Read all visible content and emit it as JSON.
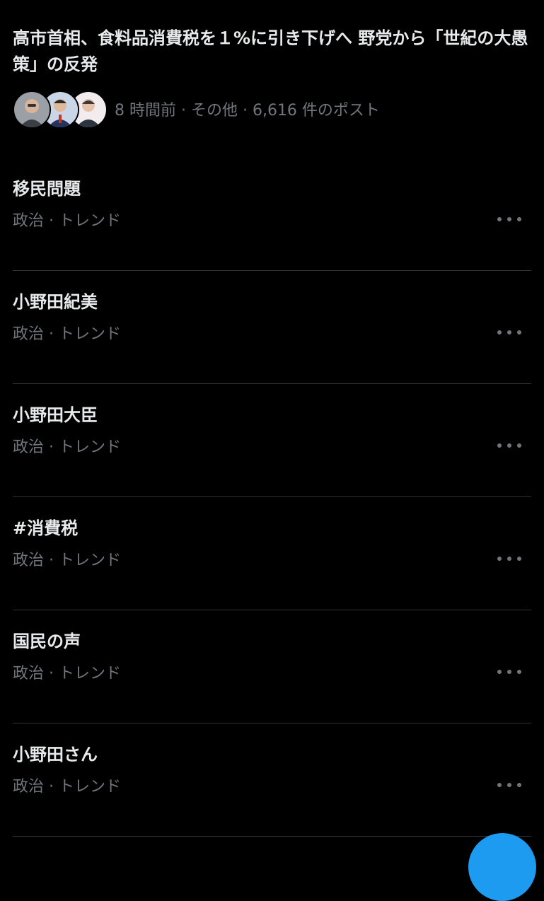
{
  "news": {
    "title": "高市首相、食料品消費税を１%に引き下げへ 野党から「世紀の大愚策」の反発",
    "meta": "8 時間前 · その他 · 6,616 件のポスト"
  },
  "trends": [
    {
      "name": "移民問題",
      "category": "政治 · トレンド"
    },
    {
      "name": "小野田紀美",
      "category": "政治 · トレンド"
    },
    {
      "name": "小野田大臣",
      "category": "政治 · トレンド"
    },
    {
      "name": "#消費税",
      "category": "政治 · トレンド"
    },
    {
      "name": "国民の声",
      "category": "政治 · トレンド"
    },
    {
      "name": "小野田さん",
      "category": "政治 · トレンド"
    }
  ],
  "icons": {
    "more": "more-horizontal-icon",
    "compose": "compose-fab"
  },
  "colors": {
    "background": "#000000",
    "primary_text": "#e7e9ea",
    "secondary_text": "#71767b",
    "divider": "#2f3336",
    "accent": "#1d9bf0"
  }
}
